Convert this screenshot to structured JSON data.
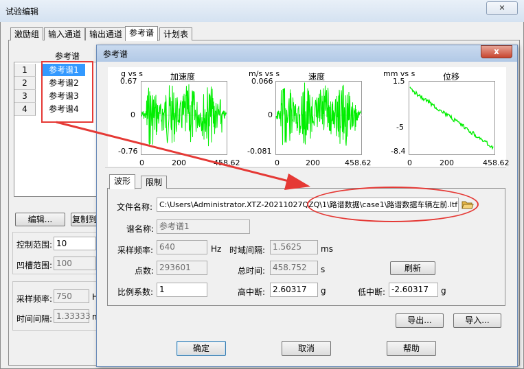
{
  "main": {
    "title": "试验编辑",
    "tabs": [
      "激励组",
      "输入通道",
      "输出通道",
      "参考谱",
      "计划表"
    ],
    "grid_header": "参考谱",
    "rows": [
      {
        "num": "1",
        "name": "参考谱1"
      },
      {
        "num": "2",
        "name": "参考谱2"
      },
      {
        "num": "3",
        "name": "参考谱3"
      },
      {
        "num": "4",
        "name": "参考谱4"
      }
    ],
    "edit_button": "编辑...",
    "copy_button": "复制到",
    "control_range_label": "控制范围:",
    "control_range_value": "10",
    "notch_range_label": "凹槽范围:",
    "notch_range_value": "100",
    "sample_rate_label": "采样频率:",
    "sample_rate_value": "750",
    "sample_rate_unit": "H",
    "time_interval_label": "时间间隔:",
    "time_interval_value": "1.33333",
    "time_interval_unit": "m"
  },
  "dialog": {
    "title": "参考谱",
    "close_glyph": "x",
    "charts": {
      "accel": {
        "title": "加速度",
        "ylabel": "g vs s",
        "ytop": "0.67",
        "ymid": "0",
        "ybot": "-0.76",
        "x0": "0",
        "x1": "200",
        "x2": "458.62"
      },
      "vel": {
        "title": "速度",
        "ylabel": "m/s vs s",
        "ytop": "0.066",
        "ymid": "0",
        "ybot": "-0.081",
        "x0": "0",
        "x1": "200",
        "x2": "458.62"
      },
      "disp": {
        "title": "位移",
        "ylabel": "mm vs s",
        "ytop": "1.5",
        "ymid": "-5",
        "ybot": "-8.4",
        "x0": "0",
        "x1": "200",
        "x2": "458.62"
      }
    },
    "tabs": [
      "波形",
      "限制"
    ],
    "file_label": "文件名称:",
    "file_value": "C:\\Users\\Administrator.XTZ-20211027QZQ\\1\\路谱数据\\case1\\路谱数据车辆左前.ltf",
    "name_label": "谱名称:",
    "name_value": "参考谱1",
    "samp_label": "采样频率:",
    "samp_value": "640",
    "samp_unit": "Hz",
    "dt_label": "时域间隔:",
    "dt_value": "1.5625",
    "dt_unit": "ms",
    "pts_label": "点数:",
    "pts_value": "293601",
    "total_label": "总时间:",
    "total_value": "458.752",
    "total_unit": "s",
    "refresh": "刷新",
    "scale_label": "比例系数:",
    "scale_value": "1",
    "high_label": "高中断:",
    "high_value": "2.60317",
    "high_unit": "g",
    "low_label": "低中断:",
    "low_value": "-2.60317",
    "low_unit": "g",
    "export": "导出...",
    "import": "导入...",
    "ok": "确定",
    "cancel": "取消",
    "help": "帮助"
  },
  "colors": {
    "signal": "#00ee00",
    "annotation": "#e53935",
    "selection": "#3399ff"
  }
}
